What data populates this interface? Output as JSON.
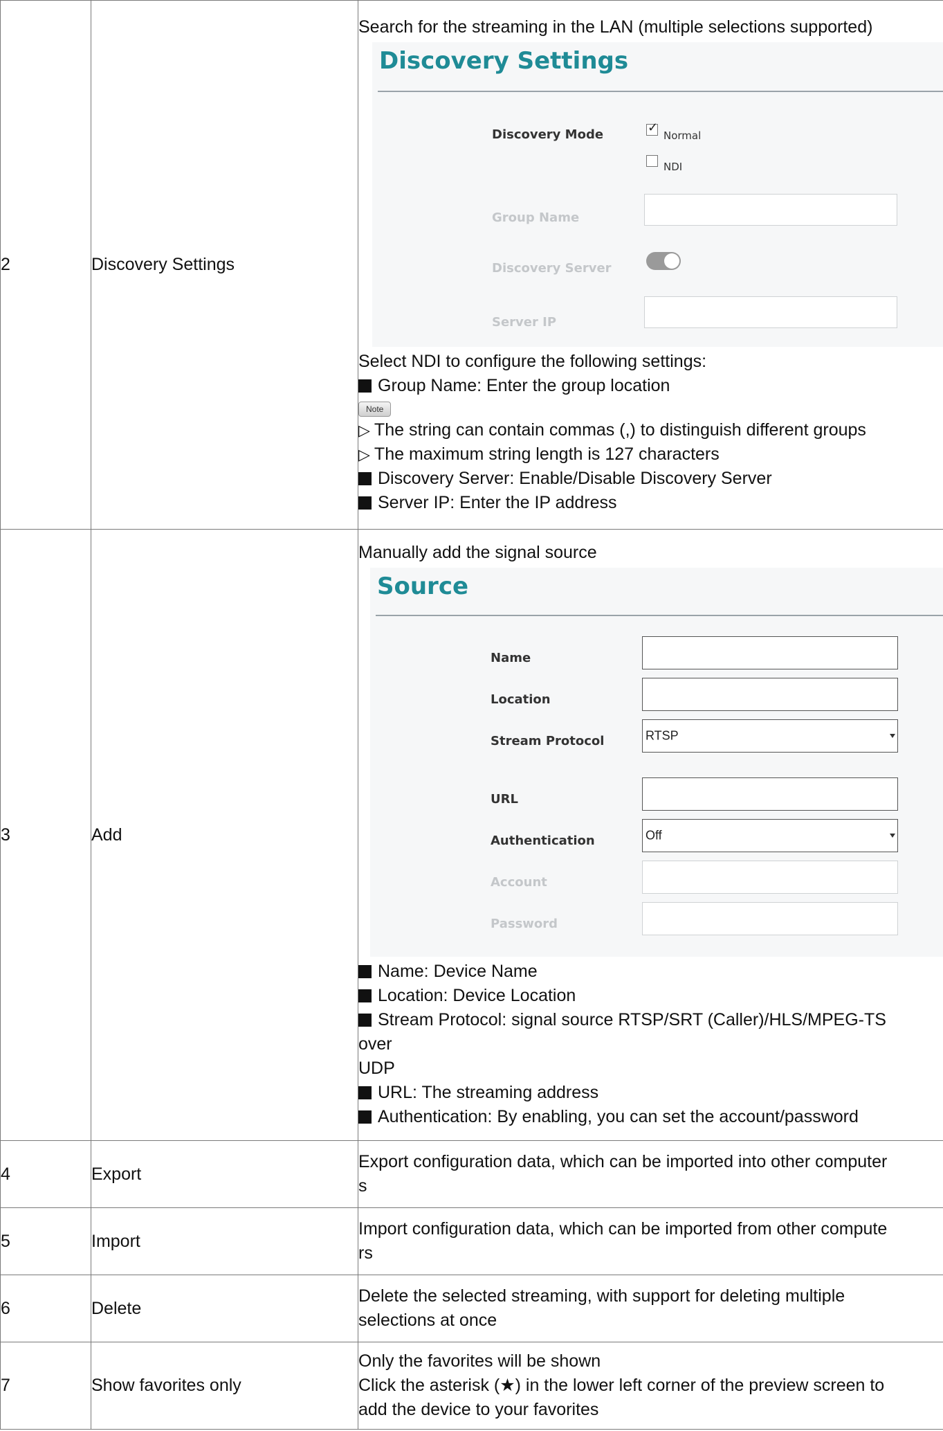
{
  "rows": [
    {
      "num": "2",
      "name": "Discovery Settings",
      "intro": "Search for the streaming in the LAN (multiple selections supported)",
      "panel": {
        "title": "Discovery Settings",
        "mode_label": "Discovery Mode",
        "opt_normal": "Normal",
        "opt_ndi": "NDI",
        "group_label": "Group Name",
        "server_label": "Discovery Server",
        "ip_label": "Server IP"
      },
      "lines": [
        "Select NDI to configure the following settings:",
        "Group Name: Enter the group location",
        "Note",
        "The string can contain commas (,) to distinguish different groups",
        "The maximum string length is 127 characters",
        "Discovery Server: Enable/Disable Discovery Server",
        "Server IP: Enter the IP address"
      ]
    },
    {
      "num": "3",
      "name": "Add",
      "intro": "Manually add the signal source",
      "panel": {
        "title": "Source",
        "name_label": "Name",
        "location_label": "Location",
        "protocol_label": "Stream Protocol",
        "protocol_value": "RTSP",
        "url_label": "URL",
        "auth_label": "Authentication",
        "auth_value": "Off",
        "account_label": "Account",
        "password_label": "Password"
      },
      "lines": [
        "Name: Device Name",
        "Location: Device Location",
        "Stream Protocol: signal source RTSP/SRT (Caller)/HLS/MPEG-TS",
        "over",
        "UDP",
        "URL: The streaming address",
        "Authentication: By enabling, you can set the account/password"
      ]
    },
    {
      "num": "4",
      "name": "Export",
      "desc1": "Export configuration data, which can be imported into other computer",
      "desc2": "s"
    },
    {
      "num": "5",
      "name": "Import",
      "desc1": "Import configuration data, which can be imported from other compute",
      "desc2": "rs"
    },
    {
      "num": "6",
      "name": "Delete",
      "desc1": "Delete the selected streaming, with support for deleting multiple",
      "desc2": "selections at once"
    },
    {
      "num": "7",
      "name": "Show favorites only",
      "desc1": "Only the favorites will be shown",
      "desc2": "Click the asterisk (★) in the lower left corner of the preview screen to",
      "desc3": "add the device to your favorites"
    }
  ]
}
